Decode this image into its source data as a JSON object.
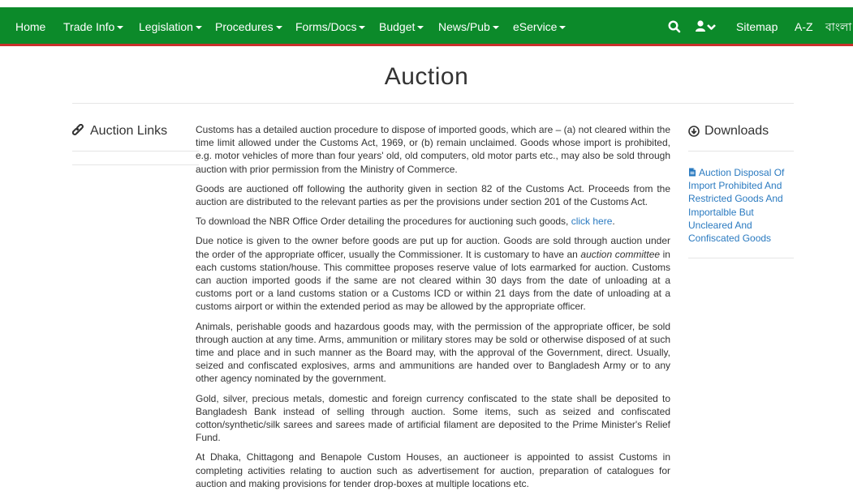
{
  "navbar": {
    "items": [
      {
        "label": "Home",
        "dropdown": false
      },
      {
        "label": "Trade Info",
        "dropdown": true
      },
      {
        "label": "Legislation",
        "dropdown": true
      },
      {
        "label": "Procedures",
        "dropdown": true
      },
      {
        "label": "Forms/Docs",
        "dropdown": true
      },
      {
        "label": "Budget",
        "dropdown": true
      },
      {
        "label": "News/Pub",
        "dropdown": true
      },
      {
        "label": "eService",
        "dropdown": true
      }
    ],
    "right_items": [
      "Sitemap",
      "A-Z",
      "বাংলা"
    ],
    "icons": [
      "search-icon",
      "user-menu-icon"
    ],
    "bg_color": "#0c8a2a",
    "border_color": "#c9302c"
  },
  "page": {
    "title": "Auction"
  },
  "left": {
    "heading": "Auction Links",
    "icon": "link-icon"
  },
  "main": {
    "paragraphs": [
      "Customs has a detailed auction procedure to dispose of imported goods, which are – (a) not cleared within the time limit allowed under the Customs Act, 1969, or (b) remain unclaimed. Goods whose import is prohibited, e.g. motor vehicles of more than four years' old, old computers, old motor parts etc., may also be sold through auction with prior permission from the Ministry of Commerce.",
      "Goods are auctioned off following the authority given in section 82 of the Customs Act. Proceeds from the auction are distributed to the relevant parties as per the provisions under section 201 of the Customs Act."
    ],
    "download_para": {
      "text": "To download the NBR Office Order detailing the procedures for auctioning such goods, ",
      "link": "click here",
      "after": "."
    },
    "notice_para": {
      "before": "Due notice is given to the owner before goods are put up for auction. Goods are sold through auction under the order of the appropriate officer, usually the Commissioner. It is customary to have an ",
      "em": "auction committee",
      "after": " in each customs station/house. This committee proposes reserve value of lots earmarked for auction. Customs can auction imported goods if the same are not cleared within 30 days from the date of unloading at a customs port or a land customs station or a Customs ICD or within 21 days from the date of unloading at a customs airport or within the extended period as may be allowed by the appropriate officer."
    },
    "more_paragraphs": [
      "Animals, perishable goods and hazardous goods may, with the permission of the appropriate officer, be sold through auction at any time. Arms, ammunition or military stores may be sold or otherwise disposed of at such time and place and in such manner as the Board may, with the approval of the Government, direct. Usually, seized and confiscated explosives, arms and ammunitions are handed over to Bangladesh Army or to any other agency nominated by the government.",
      "Gold, silver, precious metals, domestic and foreign currency confiscated to the state shall be deposited to Bangladesh Bank instead of selling through auction. Some items, such as seized and confiscated cotton/synthetic/silk sarees and sarees made of artificial filament are deposited to the Prime Minister's Relief Fund.",
      "At Dhaka, Chittagong and Benapole Custom Houses, an auctioneer is appointed to assist Customs in completing activities relating to auction such as advertisement for auction, preparation of catalogues for auction and making provisions for tender drop-boxes at multiple locations etc."
    ]
  },
  "right": {
    "heading": "Downloads",
    "icon": "download-circle-icon",
    "link": "Auction Disposal Of Import Prohibited And Restricted Goods And Importalble But Uncleared And Confiscated Goods",
    "link_icon": "file-icon",
    "link_color": "#2a7ac0"
  }
}
